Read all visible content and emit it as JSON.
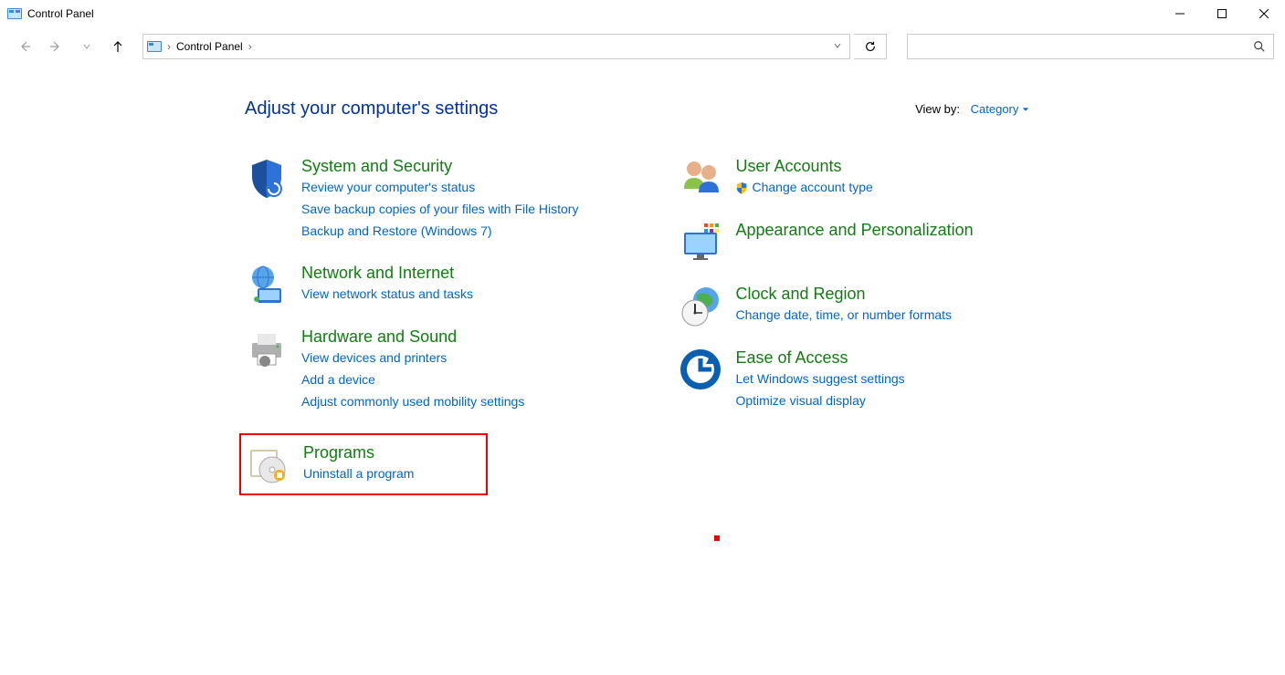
{
  "window": {
    "title": "Control Panel"
  },
  "breadcrumb": {
    "root": "Control Panel"
  },
  "page": {
    "title": "Adjust your computer's settings",
    "viewby_label": "View by:",
    "viewby_value": "Category"
  },
  "left_col": [
    {
      "title": "System and Security",
      "links": [
        "Review your computer's status",
        "Save backup copies of your files with File History",
        "Backup and Restore (Windows 7)"
      ]
    },
    {
      "title": "Network and Internet",
      "links": [
        "View network status and tasks"
      ]
    },
    {
      "title": "Hardware and Sound",
      "links": [
        "View devices and printers",
        "Add a device",
        "Adjust commonly used mobility settings"
      ]
    },
    {
      "title": "Programs",
      "links": [
        "Uninstall a program"
      ],
      "highlighted": true
    }
  ],
  "right_col": [
    {
      "title": "User Accounts",
      "links": [
        "Change account type"
      ],
      "shield": [
        true
      ]
    },
    {
      "title": "Appearance and Personalization",
      "links": []
    },
    {
      "title": "Clock and Region",
      "links": [
        "Change date, time, or number formats"
      ]
    },
    {
      "title": "Ease of Access",
      "links": [
        "Let Windows suggest settings",
        "Optimize visual display"
      ]
    }
  ]
}
